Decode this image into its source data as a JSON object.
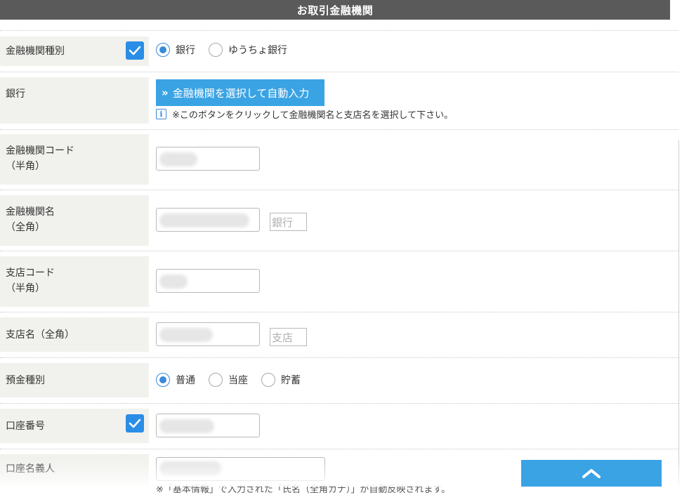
{
  "header": {
    "title": "お取引金融機関"
  },
  "rows": {
    "type": {
      "label": "金融機関種別",
      "options": [
        "銀行",
        "ゆうちょ銀行"
      ],
      "selected": "銀行"
    },
    "bank": {
      "label": "銀行",
      "button": "金融機関を選択して自動入力",
      "button_icon": "»",
      "info_icon": "i",
      "info": "※このボタンをクリックして金融機関名と支店名を選択して下さい。"
    },
    "bank_code": {
      "label1": "金融機関コード",
      "label2": "（半角）",
      "value": ""
    },
    "bank_name": {
      "label1": "金融機関名",
      "label2": "（全角）",
      "value": "",
      "suffix": "銀行"
    },
    "branch_code": {
      "label1": "支店コード",
      "label2": "（半角）",
      "value": ""
    },
    "branch_name": {
      "label": "支店名（全角）",
      "value": "",
      "suffix": "支店"
    },
    "deposit_type": {
      "label": "預金種別",
      "options": [
        "普通",
        "当座",
        "貯蓄"
      ],
      "selected": "普通"
    },
    "account_number": {
      "label": "口座番号",
      "value": ""
    },
    "account_holder": {
      "label": "口座名義人",
      "value": "",
      "note": "※「基本情報」で入力された「氏名（全角カナ）」が自動反映されます。"
    }
  },
  "colors": {
    "header_bg": "#5a5a5a",
    "accent": "#3aa3e3",
    "check": "#2a8ee6",
    "label_bg": "#f1f1ed"
  },
  "icons": {
    "check": "checkmark-icon",
    "info": "info-icon",
    "page_top": "chevron-up-icon"
  }
}
